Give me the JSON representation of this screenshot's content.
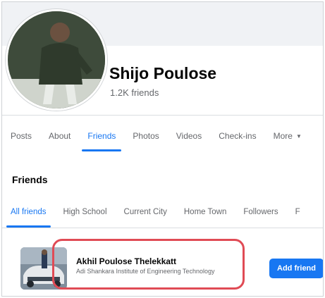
{
  "profile": {
    "name": "Shijo Poulose",
    "friend_count": "1.2K friends"
  },
  "tabs": [
    {
      "label": "Posts",
      "active": false
    },
    {
      "label": "About",
      "active": false
    },
    {
      "label": "Friends",
      "active": true
    },
    {
      "label": "Photos",
      "active": false
    },
    {
      "label": "Videos",
      "active": false
    },
    {
      "label": "Check-ins",
      "active": false
    },
    {
      "label": "More",
      "active": false
    }
  ],
  "friends_section": {
    "title": "Friends",
    "subtabs": [
      {
        "label": "All friends",
        "active": true
      },
      {
        "label": "High School",
        "active": false
      },
      {
        "label": "Current City",
        "active": false
      },
      {
        "label": "Home Town",
        "active": false
      },
      {
        "label": "Followers",
        "active": false
      },
      {
        "label": "F",
        "active": false
      }
    ]
  },
  "friend": {
    "name": "Akhil Poulose Thelekkatt",
    "school": "Adi Shankara Institute of Engineering Technology",
    "add_label": "Add friend"
  },
  "colors": {
    "accent": "#1877f2",
    "highlight": "#e04b55"
  },
  "icons": {
    "more": "caret-down-icon"
  }
}
